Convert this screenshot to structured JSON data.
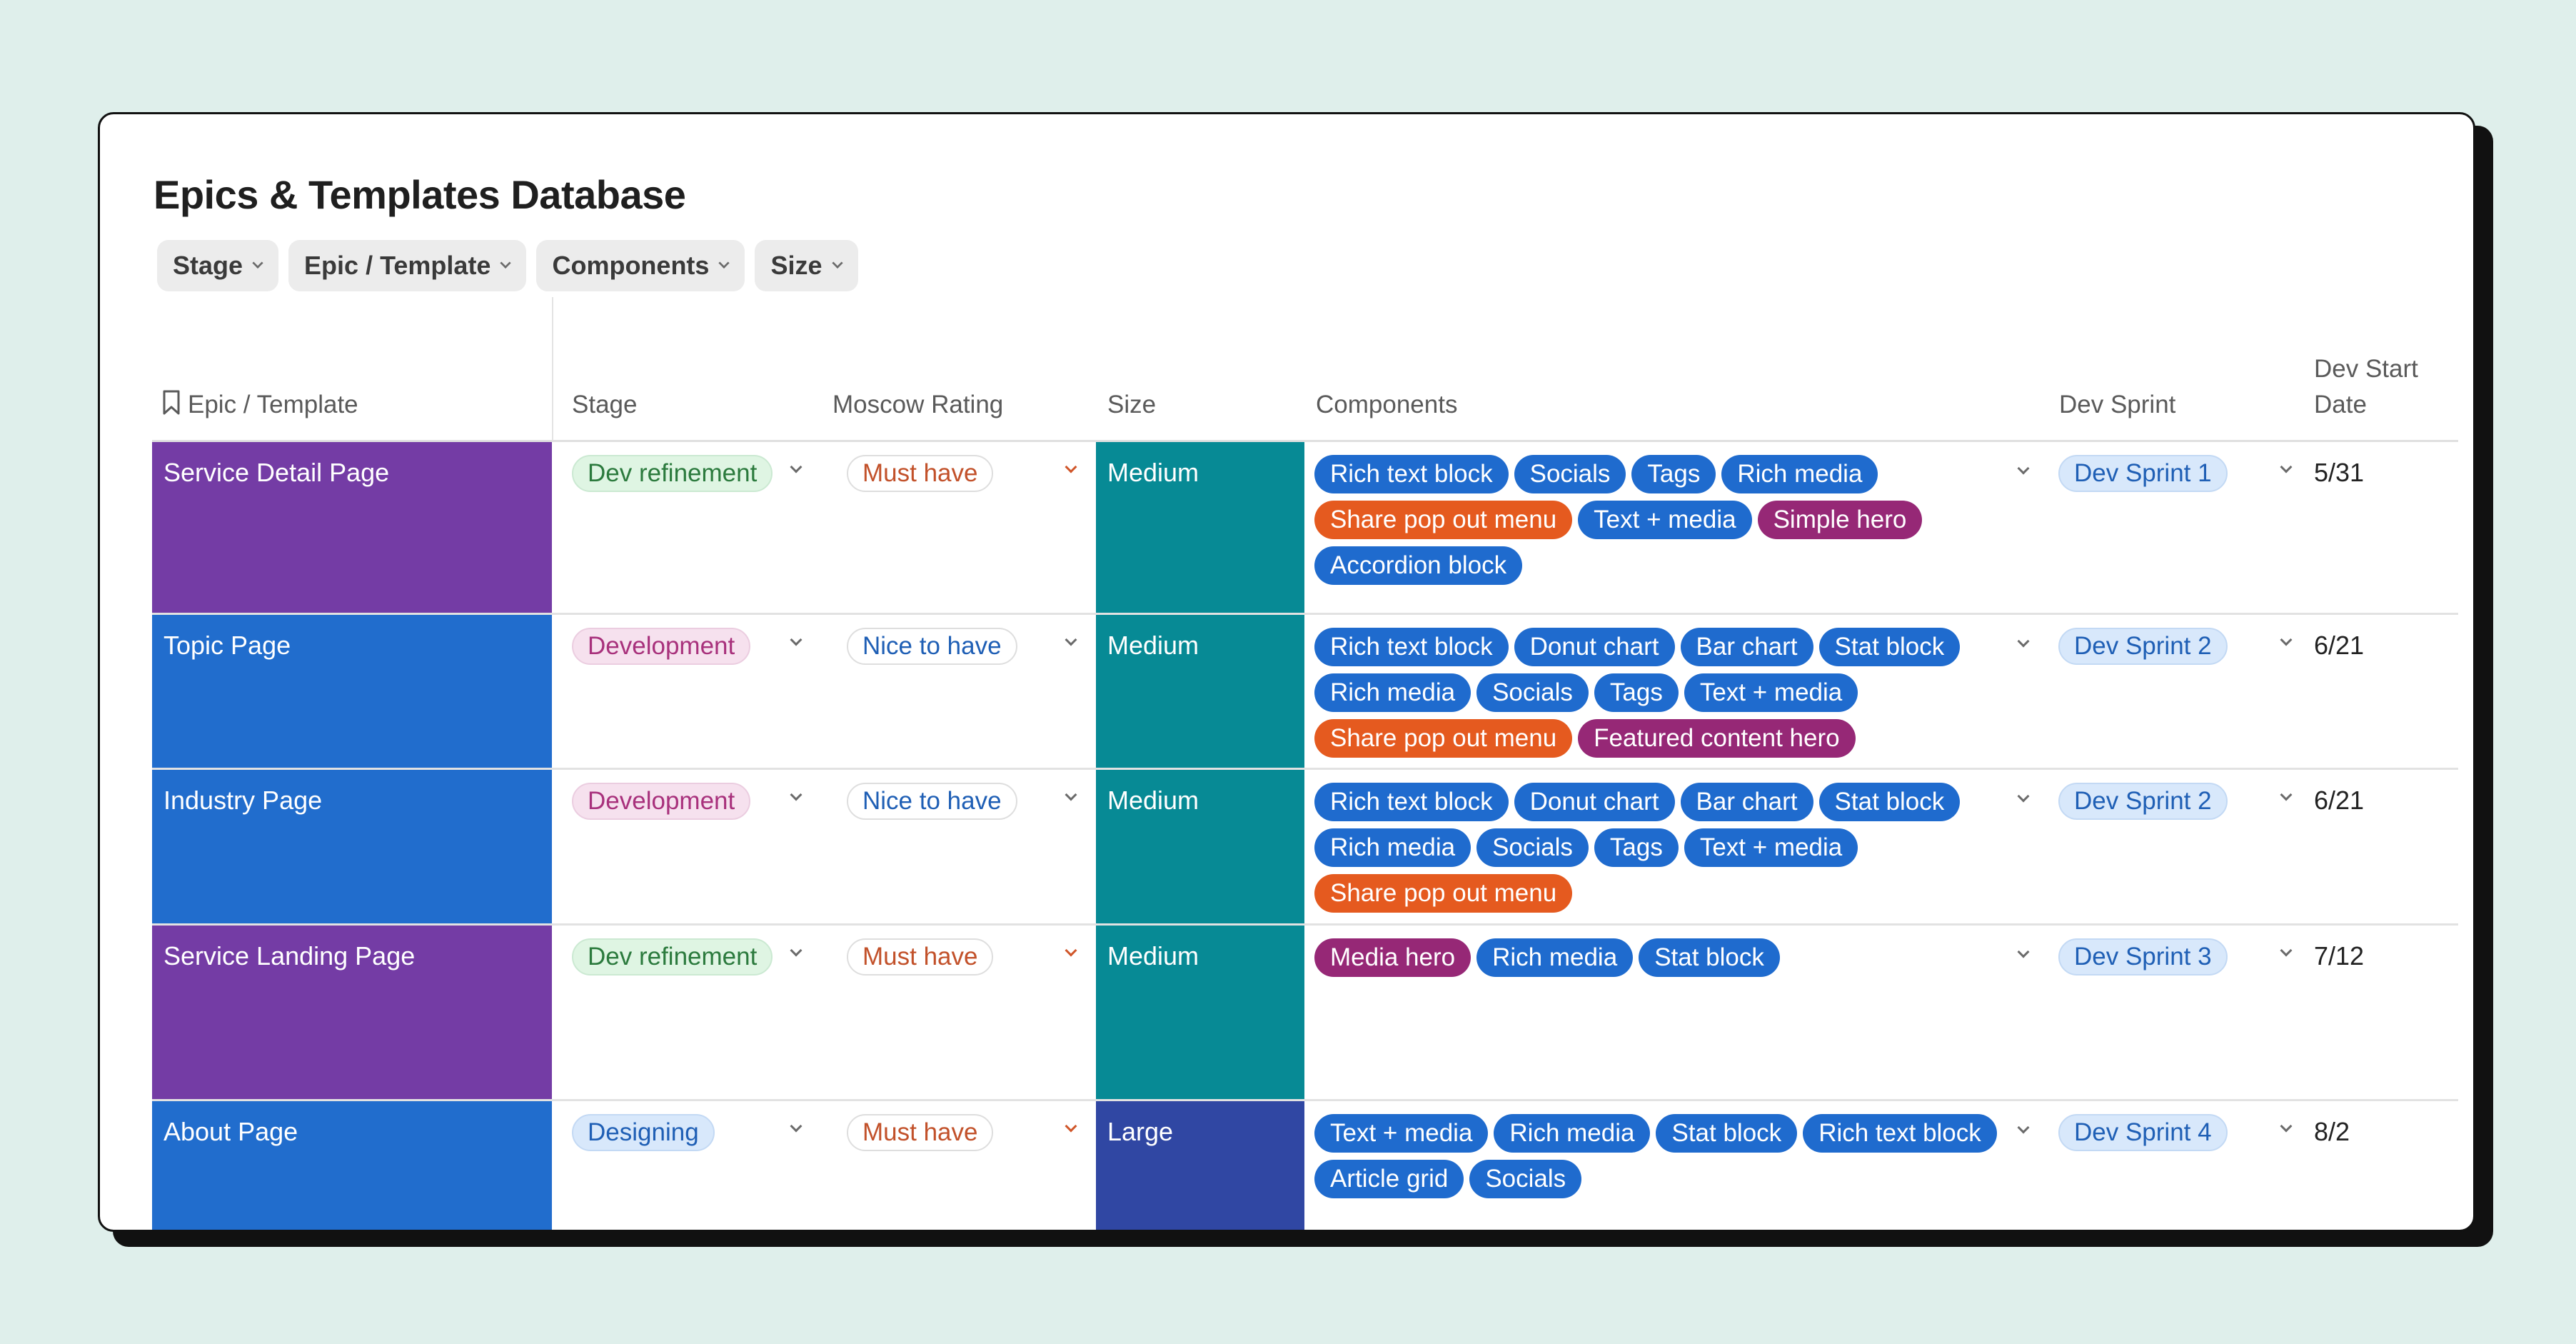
{
  "page": {
    "title": "Epics & Templates Database",
    "filters": [
      {
        "label": "Stage"
      },
      {
        "label": "Epic / Template"
      },
      {
        "label": "Components"
      },
      {
        "label": "Size"
      }
    ]
  },
  "columns": {
    "epic": "Epic / Template",
    "stage": "Stage",
    "moscow": "Moscow Rating",
    "size": "Size",
    "components": "Components",
    "sprint": "Dev Sprint",
    "date_line1": "Dev Start",
    "date_line2": "Date"
  },
  "colors": {
    "purple_epic": "#743ca5",
    "blue_epic": "#216dcd",
    "medium_size": "#078a95",
    "large_size": "#3047a3",
    "tag_blue": "#1f6bce",
    "tag_orange": "#e55a1f",
    "tag_magenta": "#962876"
  },
  "rows": [
    {
      "epic": "Service Detail Page",
      "epic_color": "#743ca5",
      "stage": "Dev refinement",
      "stage_kind": "dev-refinement",
      "moscow": "Must have",
      "moscow_kind": "must",
      "size": "Medium",
      "size_color": "#078a95",
      "components": [
        {
          "label": "Rich text block",
          "color": "#1f6bce"
        },
        {
          "label": "Socials",
          "color": "#1f6bce"
        },
        {
          "label": "Tags",
          "color": "#1f6bce"
        },
        {
          "label": "Rich media",
          "color": "#1f6bce"
        },
        {
          "label": "Share pop out menu",
          "color": "#e55a1f"
        },
        {
          "label": "Text + media",
          "color": "#1f6bce"
        },
        {
          "label": "Simple hero",
          "color": "#962876"
        },
        {
          "label": "Accordion block",
          "color": "#1f6bce"
        }
      ],
      "sprint": "Dev Sprint 1",
      "date": "5/31"
    },
    {
      "epic": "Topic Page",
      "epic_color": "#216dcd",
      "stage": "Development",
      "stage_kind": "development",
      "moscow": "Nice to have",
      "moscow_kind": "nice",
      "size": "Medium",
      "size_color": "#078a95",
      "components": [
        {
          "label": "Rich text block",
          "color": "#1f6bce"
        },
        {
          "label": "Donut chart",
          "color": "#1f6bce"
        },
        {
          "label": "Bar chart",
          "color": "#1f6bce"
        },
        {
          "label": "Stat block",
          "color": "#1f6bce"
        },
        {
          "label": "Rich media",
          "color": "#1f6bce"
        },
        {
          "label": "Socials",
          "color": "#1f6bce"
        },
        {
          "label": "Tags",
          "color": "#1f6bce"
        },
        {
          "label": "Text + media",
          "color": "#1f6bce"
        },
        {
          "label": "Share pop out menu",
          "color": "#e55a1f"
        },
        {
          "label": "Featured content hero",
          "color": "#962876"
        }
      ],
      "sprint": "Dev Sprint 2",
      "date": "6/21"
    },
    {
      "epic": "Industry Page",
      "epic_color": "#216dcd",
      "stage": "Development",
      "stage_kind": "development",
      "moscow": "Nice to have",
      "moscow_kind": "nice",
      "size": "Medium",
      "size_color": "#078a95",
      "components": [
        {
          "label": "Rich text block",
          "color": "#1f6bce"
        },
        {
          "label": "Donut chart",
          "color": "#1f6bce"
        },
        {
          "label": "Bar chart",
          "color": "#1f6bce"
        },
        {
          "label": "Stat block",
          "color": "#1f6bce"
        },
        {
          "label": "Rich media",
          "color": "#1f6bce"
        },
        {
          "label": "Socials",
          "color": "#1f6bce"
        },
        {
          "label": "Tags",
          "color": "#1f6bce"
        },
        {
          "label": "Text + media",
          "color": "#1f6bce"
        },
        {
          "label": "Share pop out menu",
          "color": "#e55a1f"
        }
      ],
      "sprint": "Dev Sprint 2",
      "date": "6/21"
    },
    {
      "epic": "Service Landing Page",
      "epic_color": "#743ca5",
      "stage": "Dev refinement",
      "stage_kind": "dev-refinement",
      "moscow": "Must have",
      "moscow_kind": "must",
      "size": "Medium",
      "size_color": "#078a95",
      "components": [
        {
          "label": "Media hero",
          "color": "#962876"
        },
        {
          "label": "Rich media",
          "color": "#1f6bce"
        },
        {
          "label": "Stat block",
          "color": "#1f6bce"
        }
      ],
      "sprint": "Dev Sprint 3",
      "date": "7/12"
    },
    {
      "epic": "About Page",
      "epic_color": "#216dcd",
      "stage": "Designing",
      "stage_kind": "designing",
      "moscow": "Must have",
      "moscow_kind": "must",
      "size": "Large",
      "size_color": "#3047a3",
      "components": [
        {
          "label": "Text + media",
          "color": "#1f6bce"
        },
        {
          "label": "Rich media",
          "color": "#1f6bce"
        },
        {
          "label": "Stat block",
          "color": "#1f6bce"
        },
        {
          "label": "Rich text block",
          "color": "#1f6bce"
        },
        {
          "label": "Article grid",
          "color": "#1f6bce"
        },
        {
          "label": "Socials",
          "color": "#1f6bce"
        }
      ],
      "sprint": "Dev Sprint 4",
      "date": "8/2"
    }
  ]
}
